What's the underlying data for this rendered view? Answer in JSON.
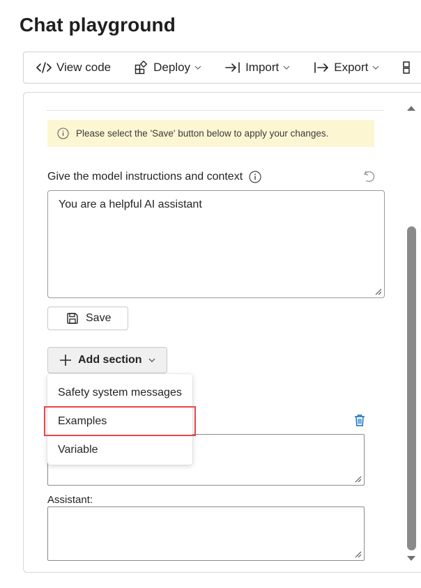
{
  "page": {
    "title": "Chat playground"
  },
  "toolbar": {
    "view_code": "View code",
    "deploy": "Deploy",
    "import": "Import",
    "export": "Export"
  },
  "warning": {
    "text": "Please select the 'Save' button below to apply your changes."
  },
  "instructions": {
    "label": "Give the model instructions and context",
    "value": "You are a helpful AI assistant"
  },
  "save_button": {
    "label": "Save"
  },
  "add_section": {
    "label": "Add section",
    "menu": [
      "Safety system messages",
      "Examples",
      "Variable"
    ]
  },
  "examples": {
    "assistant_label": "Assistant:"
  },
  "colors": {
    "accent": "#0f6cbd",
    "warning_bg": "#fdf6d3",
    "highlight": "#e8474b"
  }
}
